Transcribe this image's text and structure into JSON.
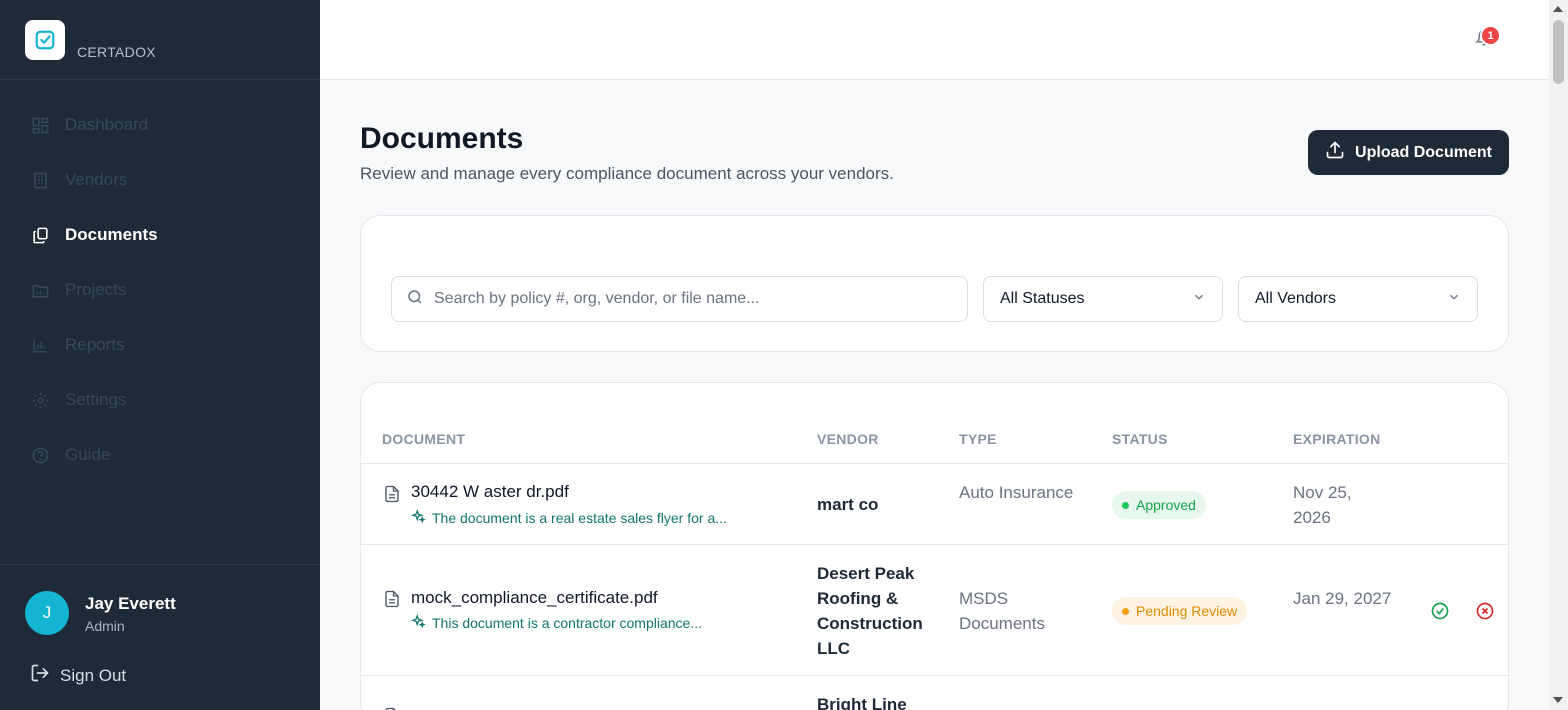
{
  "brand": {
    "name": "CERTADOX"
  },
  "sidebar": {
    "items": [
      {
        "label": "Dashboard",
        "icon": "dashboard-icon",
        "active": false
      },
      {
        "label": "Vendors",
        "icon": "building-icon",
        "active": false
      },
      {
        "label": "Documents",
        "icon": "documents-icon",
        "active": true
      },
      {
        "label": "Projects",
        "icon": "folder-chart-icon",
        "active": false
      },
      {
        "label": "Reports",
        "icon": "bar-chart-icon",
        "active": false
      },
      {
        "label": "Settings",
        "icon": "gear-icon",
        "active": false
      },
      {
        "label": "Guide",
        "icon": "help-circle-icon",
        "active": false
      }
    ]
  },
  "user": {
    "initial": "J",
    "name": "Jay Everett",
    "role": "Admin"
  },
  "signout": {
    "label": "Sign Out"
  },
  "notifications": {
    "count": "1"
  },
  "page": {
    "title": "Documents",
    "subtitle": "Review and manage every compliance document across your vendors."
  },
  "upload": {
    "label": "Upload Document"
  },
  "filters": {
    "search_placeholder": "Search by policy #, org, vendor, or file name...",
    "status_value": "All Statuses",
    "vendor_value": "All Vendors"
  },
  "table": {
    "headers": [
      "DOCUMENT",
      "VENDOR",
      "TYPE",
      "STATUS",
      "EXPIRATION"
    ],
    "rows": [
      {
        "name": "30442 W aster dr.pdf",
        "summary": "The document is a real estate sales flyer for a...",
        "vendor": "mart co",
        "type": "Auto Insurance",
        "status": "Approved",
        "expiration": "Nov 25, 2026"
      },
      {
        "name": "mock_compliance_certificate.pdf",
        "summary": "This document is a contractor compliance...",
        "vendor": "Desert Peak Roofing & Construction LLC",
        "type": "MSDS Documents",
        "status": "Pending Review",
        "expiration": "Jan 29, 2027"
      },
      {
        "vendor": "Bright Line"
      }
    ]
  },
  "colors": {
    "sidebar_bg": "#1e2a38",
    "accent": "#13b5d3",
    "approved": "#16a34a",
    "pending": "#e08a00",
    "reject": "#dc2626"
  }
}
